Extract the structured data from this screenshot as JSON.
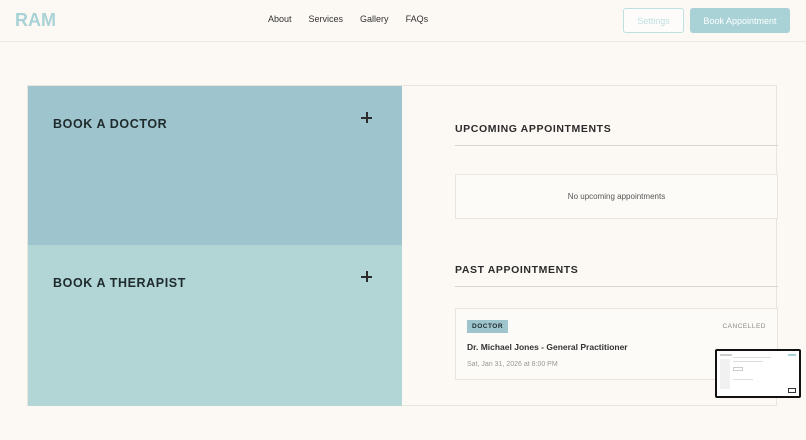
{
  "brand": {
    "logo_text": "RAM",
    "color": "#a9d2d6"
  },
  "nav": {
    "items": [
      "About",
      "Services",
      "Gallery",
      "FAQs"
    ]
  },
  "header": {
    "settings_label": "Settings",
    "book_label": "Book Appointment"
  },
  "cards": {
    "doctor": {
      "title": "BOOK A DOCTOR",
      "color": "#9ec5cd"
    },
    "therapist": {
      "title": "BOOK A THERAPIST",
      "color": "#b2d6d6"
    }
  },
  "upcoming": {
    "title": "UPCOMING APPOINTMENTS",
    "empty_text": "No upcoming appointments"
  },
  "past": {
    "title": "PAST APPOINTMENTS",
    "items": [
      {
        "badge": "DOCTOR",
        "status": "CANCELLED",
        "name": "Dr. Michael Jones - General Practitioner",
        "time": "Sat, Jan 31, 2026 at 8:00 PM"
      }
    ]
  },
  "preview": {
    "icon": "screen-preview-icon"
  }
}
